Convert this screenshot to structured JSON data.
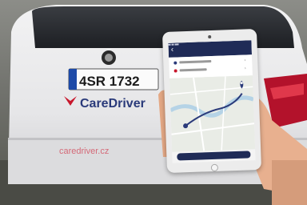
{
  "scene": {
    "license_plate": "4SR 1732",
    "plate_country": "CZ",
    "car_brand_text": "CareDriver",
    "car_url_text": "caredriver.cz",
    "car_logo": "skoda-logo-icon"
  },
  "tablet_app": {
    "title": "",
    "confirm_label": "",
    "icons": {
      "back": "back-arrow-icon",
      "pickup": "pickup-dot-icon",
      "destination": "destination-dot-icon",
      "map_pin": "map-pin-icon"
    }
  },
  "colors": {
    "app_bar": "#1f2b57",
    "car_body": "#e9e9ea",
    "taillight": "#b3122b",
    "brand_red": "#c8172c",
    "plate_blue": "#1d4aa8"
  }
}
